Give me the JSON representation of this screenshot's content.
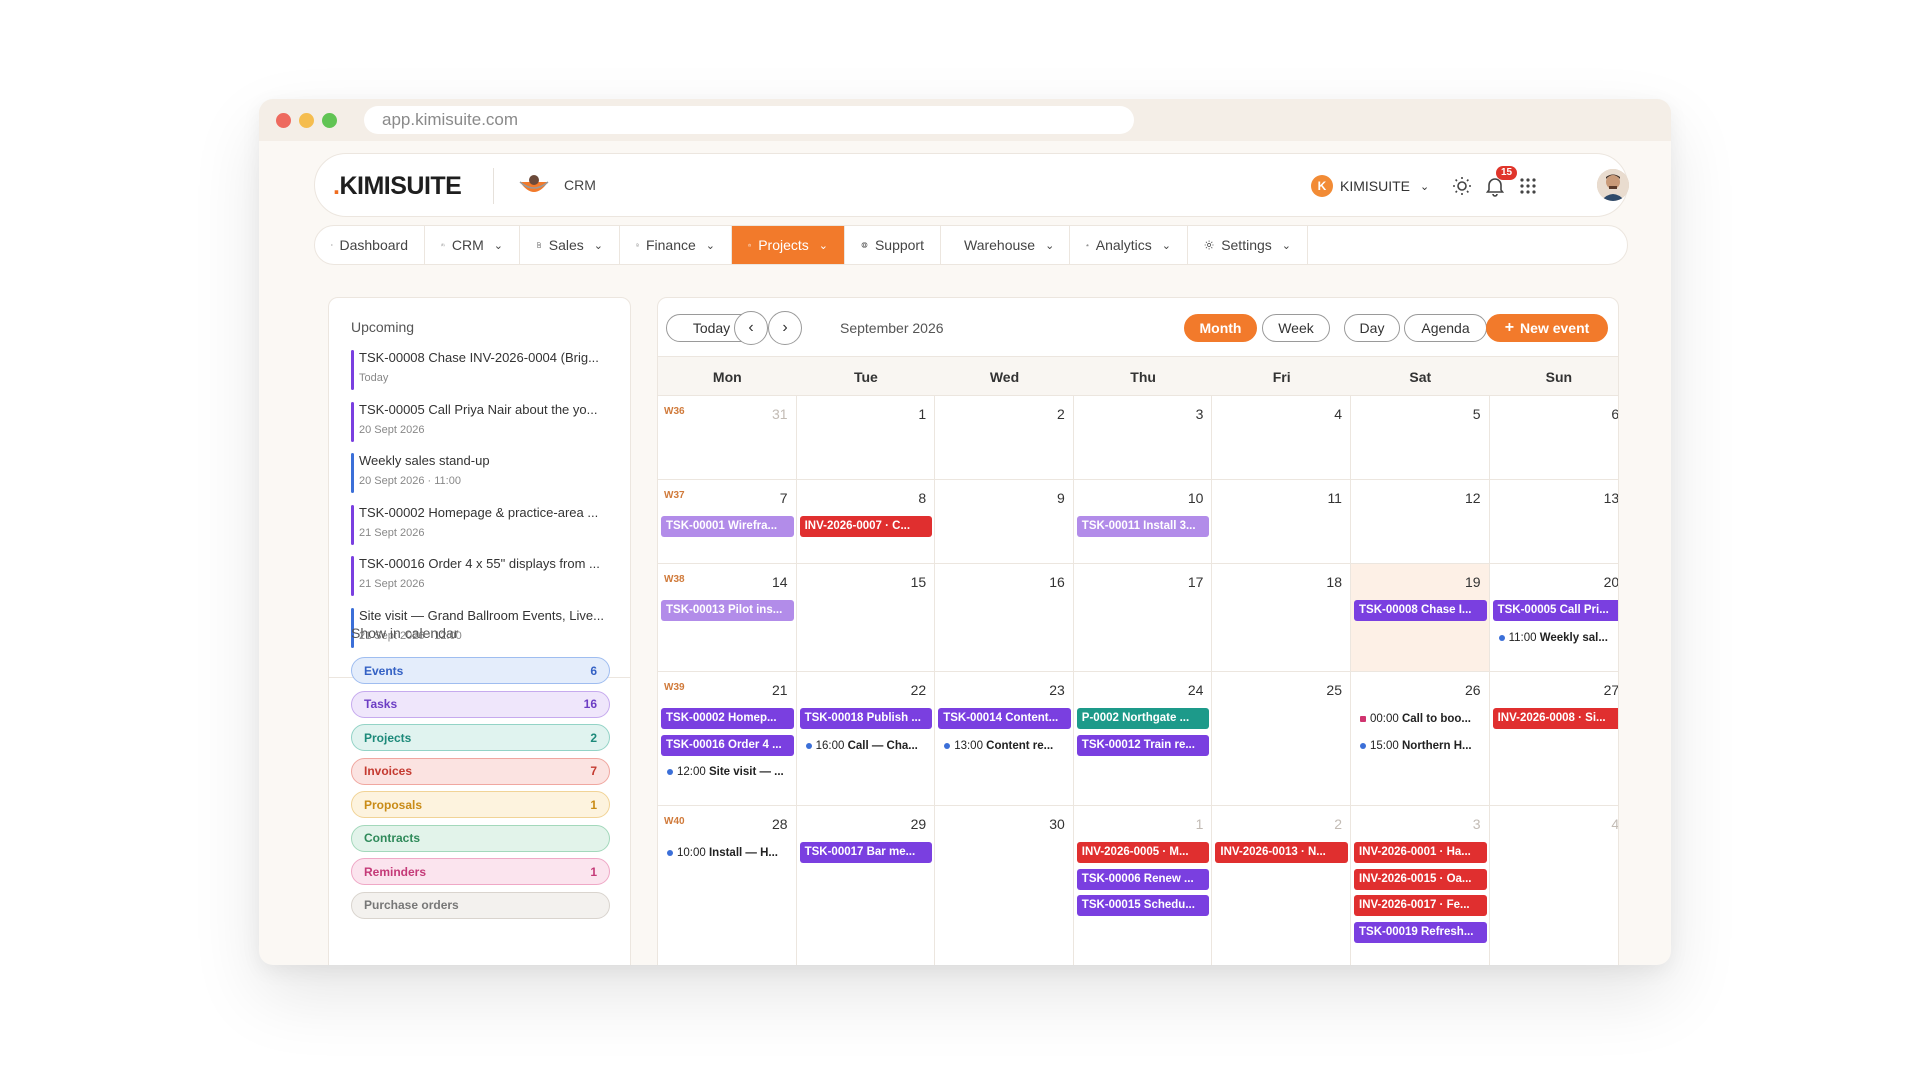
{
  "browser": {
    "url": "app.kimisuite.com"
  },
  "header": {
    "logo_dot": ".",
    "logo_text": "KIMISUITE",
    "app_name": "CRM",
    "workspace_initial": "K",
    "workspace_name": "KIMISUITE",
    "notifications_count": "15"
  },
  "nav": [
    {
      "label": "Dashboard",
      "icon": "grid-icon",
      "has_menu": false
    },
    {
      "label": "CRM",
      "icon": "people-icon",
      "has_menu": true
    },
    {
      "label": "Sales",
      "icon": "document-icon",
      "has_menu": true
    },
    {
      "label": "Finance",
      "icon": "file-icon",
      "has_menu": true
    },
    {
      "label": "Projects",
      "icon": "briefcase-icon",
      "has_menu": true,
      "active": true
    },
    {
      "label": "Support",
      "icon": "lifebuoy-icon",
      "has_menu": false
    },
    {
      "label": "Warehouse",
      "icon": "box-icon",
      "has_menu": true
    },
    {
      "label": "Analytics",
      "icon": "bar-chart-icon",
      "has_menu": true
    },
    {
      "label": "Settings",
      "icon": "gear-icon",
      "has_menu": true
    }
  ],
  "sidebar": {
    "upcoming_title": "Upcoming",
    "upcoming": [
      {
        "title": "TSK-00008 Chase INV-2026-0004 (Brig...",
        "sub": "Today",
        "color": "#7a3fe0"
      },
      {
        "title": "TSK-00005 Call Priya Nair about the yo...",
        "sub": "20 Sept 2026",
        "color": "#7a3fe0"
      },
      {
        "title": "Weekly sales stand-up",
        "sub": "20 Sept 2026 · 11:00",
        "color": "#3b6fd8"
      },
      {
        "title": "TSK-00002 Homepage & practice-area ...",
        "sub": "21 Sept 2026",
        "color": "#7a3fe0"
      },
      {
        "title": "TSK-00016 Order 4 x 55\" displays from ...",
        "sub": "21 Sept 2026",
        "color": "#7a3fe0"
      },
      {
        "title": "Site visit — Grand Ballroom Events, Live...",
        "sub": "21 Sept 2026 · 12:00",
        "color": "#3b6fd8"
      }
    ],
    "show_title": "Show in calendar",
    "filters": [
      {
        "label": "Events",
        "count": "6",
        "bg": "#e4edfb",
        "border": "#9fbdf0",
        "fg": "#3461c4"
      },
      {
        "label": "Tasks",
        "count": "16",
        "bg": "#efe6fb",
        "border": "#c6aaee",
        "fg": "#6c3dc4"
      },
      {
        "label": "Projects",
        "count": "2",
        "bg": "#e0f3ef",
        "border": "#93d3c6",
        "fg": "#1d8a7a"
      },
      {
        "label": "Invoices",
        "count": "7",
        "bg": "#fbe3e1",
        "border": "#f0a7a0",
        "fg": "#c43a30"
      },
      {
        "label": "Proposals",
        "count": "1",
        "bg": "#fdf3de",
        "border": "#f1d396",
        "fg": "#c98b16"
      },
      {
        "label": "Contracts",
        "count": "",
        "bg": "#e2f3ea",
        "border": "#a3d8bb",
        "fg": "#2f8a5a"
      },
      {
        "label": "Reminders",
        "count": "1",
        "bg": "#fbe4ee",
        "border": "#efa8c6",
        "fg": "#c43a78"
      },
      {
        "label": "Purchase orders",
        "count": "",
        "bg": "#f3f1ee",
        "border": "#d9d4ce",
        "fg": "#777777"
      }
    ]
  },
  "calendar": {
    "today_label": "Today",
    "month_title": "September 2026",
    "views": [
      {
        "label": "Month",
        "active": true
      },
      {
        "label": "Week",
        "active": false
      },
      {
        "label": "Day",
        "active": false
      },
      {
        "label": "Agenda",
        "active": false
      }
    ],
    "new_event_label": "New event",
    "dow": [
      "Mon",
      "Tue",
      "Wed",
      "Thu",
      "Fri",
      "Sat",
      "Sun"
    ],
    "weeks": [
      {
        "wk": "W36",
        "days": [
          {
            "d": "31",
            "other": true
          },
          {
            "d": "1"
          },
          {
            "d": "2"
          },
          {
            "d": "3"
          },
          {
            "d": "4"
          },
          {
            "d": "5"
          },
          {
            "d": "6"
          }
        ]
      },
      {
        "wk": "W37",
        "days": [
          {
            "d": "7"
          },
          {
            "d": "8"
          },
          {
            "d": "9"
          },
          {
            "d": "10"
          },
          {
            "d": "11"
          },
          {
            "d": "12"
          },
          {
            "d": "13"
          }
        ]
      },
      {
        "wk": "W38",
        "days": [
          {
            "d": "14"
          },
          {
            "d": "15"
          },
          {
            "d": "16"
          },
          {
            "d": "17"
          },
          {
            "d": "18"
          },
          {
            "d": "19",
            "today": true
          },
          {
            "d": "20"
          }
        ]
      },
      {
        "wk": "W39",
        "days": [
          {
            "d": "21"
          },
          {
            "d": "22"
          },
          {
            "d": "23"
          },
          {
            "d": "24"
          },
          {
            "d": "25"
          },
          {
            "d": "26"
          },
          {
            "d": "27"
          }
        ]
      },
      {
        "wk": "W40",
        "days": [
          {
            "d": "28"
          },
          {
            "d": "29"
          },
          {
            "d": "30"
          },
          {
            "d": "1",
            "other": true
          },
          {
            "d": "2",
            "other": true
          },
          {
            "d": "3",
            "other": true
          },
          {
            "d": "4",
            "other": true
          }
        ]
      }
    ],
    "events": [
      {
        "week": 1,
        "day": 0,
        "slot": 0,
        "kind": "task-l",
        "text": "TSK-00001 Wirefra..."
      },
      {
        "week": 1,
        "day": 1,
        "slot": 0,
        "kind": "inv",
        "text": "INV-2026-0007 · C..."
      },
      {
        "week": 1,
        "day": 3,
        "slot": 0,
        "kind": "task-l",
        "text": "TSK-00011 Install 3..."
      },
      {
        "week": 2,
        "day": 0,
        "slot": 0,
        "kind": "task-l",
        "text": "TSK-00013 Pilot ins..."
      },
      {
        "week": 2,
        "day": 5,
        "slot": 0,
        "kind": "task",
        "text": "TSK-00008 Chase I..."
      },
      {
        "week": 2,
        "day": 6,
        "slot": 0,
        "kind": "task",
        "text": "TSK-00005 Call Pri..."
      },
      {
        "week": 2,
        "day": 6,
        "slot": 1,
        "kind": "dot",
        "time": "11:00",
        "text": "Weekly sal...",
        "dot": "#3b6fd8"
      },
      {
        "week": 3,
        "day": 0,
        "slot": 0,
        "kind": "task",
        "text": "TSK-00002 Homep..."
      },
      {
        "week": 3,
        "day": 0,
        "slot": 1,
        "kind": "task",
        "text": "TSK-00016 Order 4 ..."
      },
      {
        "week": 3,
        "day": 0,
        "slot": 2,
        "kind": "dot",
        "time": "12:00",
        "text": "Site visit — ...",
        "dot": "#3b6fd8"
      },
      {
        "week": 3,
        "day": 1,
        "slot": 0,
        "kind": "task",
        "text": "TSK-00018 Publish ..."
      },
      {
        "week": 3,
        "day": 1,
        "slot": 1,
        "kind": "dot",
        "time": "16:00",
        "text": "Call — Cha...",
        "dot": "#3b6fd8"
      },
      {
        "week": 3,
        "day": 2,
        "slot": 0,
        "kind": "task",
        "text": "TSK-00014 Content..."
      },
      {
        "week": 3,
        "day": 2,
        "slot": 1,
        "kind": "dot",
        "time": "13:00",
        "text": "Content re...",
        "dot": "#3b6fd8"
      },
      {
        "week": 3,
        "day": 3,
        "slot": 0,
        "kind": "proj",
        "text": "P-0002 Northgate ..."
      },
      {
        "week": 3,
        "day": 3,
        "slot": 1,
        "kind": "task",
        "text": "TSK-00012 Train re..."
      },
      {
        "week": 3,
        "day": 5,
        "slot": 0,
        "kind": "dot",
        "time": "00:00",
        "text": "Call to boo...",
        "dot": "#d0346f",
        "square": true
      },
      {
        "week": 3,
        "day": 5,
        "slot": 1,
        "kind": "dot",
        "time": "15:00",
        "text": "Northern H...",
        "dot": "#3b6fd8"
      },
      {
        "week": 3,
        "day": 6,
        "slot": 0,
        "kind": "inv",
        "text": "INV-2026-0008 · Si..."
      },
      {
        "week": 4,
        "day": 0,
        "slot": 0,
        "kind": "dot",
        "time": "10:00",
        "text": "Install — H...",
        "dot": "#3b6fd8"
      },
      {
        "week": 4,
        "day": 1,
        "slot": 0,
        "kind": "task",
        "text": "TSK-00017 Bar me..."
      },
      {
        "week": 4,
        "day": 3,
        "slot": 0,
        "kind": "inv",
        "text": "INV-2026-0005 · M..."
      },
      {
        "week": 4,
        "day": 3,
        "slot": 1,
        "kind": "task",
        "text": "TSK-00006 Renew ..."
      },
      {
        "week": 4,
        "day": 3,
        "slot": 2,
        "kind": "task",
        "text": "TSK-00015 Schedu..."
      },
      {
        "week": 4,
        "day": 4,
        "slot": 0,
        "kind": "inv",
        "text": "INV-2026-0013 · N..."
      },
      {
        "week": 4,
        "day": 5,
        "slot": 0,
        "kind": "inv",
        "text": "INV-2026-0001 · Ha..."
      },
      {
        "week": 4,
        "day": 5,
        "slot": 1,
        "kind": "inv",
        "text": "INV-2026-0015 · Oa..."
      },
      {
        "week": 4,
        "day": 5,
        "slot": 2,
        "kind": "inv",
        "text": "INV-2026-0017 · Fe..."
      },
      {
        "week": 4,
        "day": 5,
        "slot": 3,
        "kind": "task",
        "text": "TSK-00019 Refresh..."
      }
    ]
  }
}
